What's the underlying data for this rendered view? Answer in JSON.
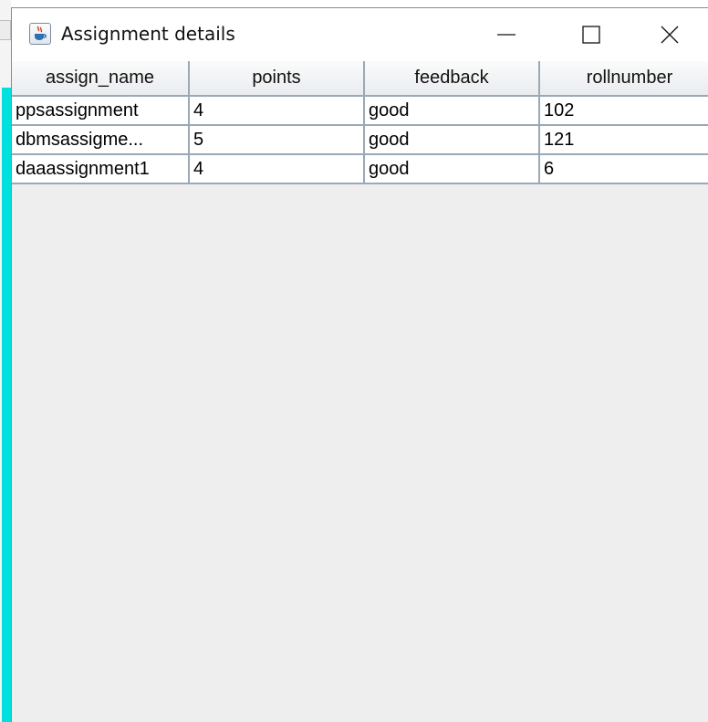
{
  "window": {
    "title": "Assignment details",
    "icon": "java-cup-icon",
    "controls": {
      "minimize": "minimize-icon",
      "maximize": "maximize-icon",
      "close": "close-icon"
    }
  },
  "table": {
    "columns": [
      "assign_name",
      "points",
      "feedback",
      "rollnumber"
    ],
    "rows": [
      [
        "ppsassignment",
        "4",
        "good",
        "102"
      ],
      [
        "dbmsassigme...",
        "5",
        "good",
        "121"
      ],
      [
        "daaassignment1",
        "4",
        "good",
        "6"
      ]
    ]
  },
  "colors": {
    "header_border": "#9aa9b8",
    "panel_background": "#eeeeee",
    "background_accent": "#00e0de"
  }
}
